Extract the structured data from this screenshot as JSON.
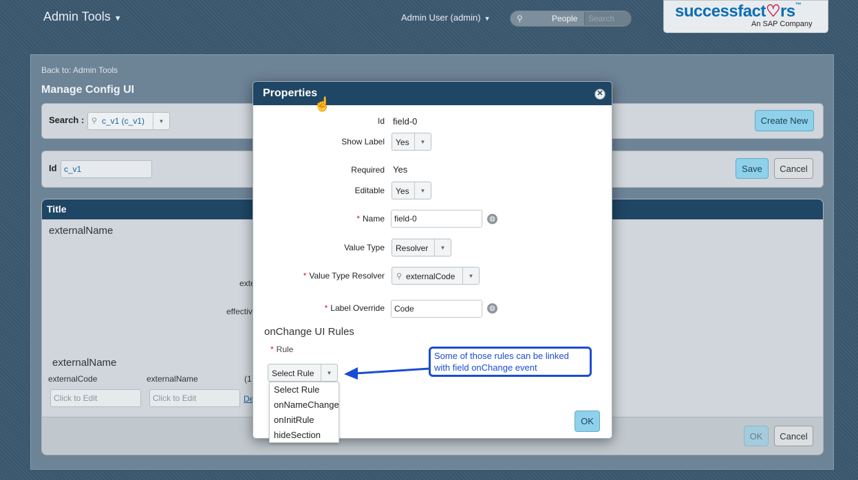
{
  "header": {
    "admin_tools": "Admin Tools",
    "admin_user": "Admin User (admin)",
    "search_scope": "People",
    "search_placeholder": "Search",
    "logo_text_a": "successfact",
    "logo_text_b": "rs",
    "logo_sub": "An SAP Company"
  },
  "page": {
    "back_link": "Back to: Admin Tools",
    "title": "Manage Config UI",
    "search_label": "Search :",
    "search_value": "c_v1 (c_v1)",
    "create_new": "Create New",
    "id_label": "Id",
    "id_value": "c_v1",
    "save": "Save",
    "cancel": "Cancel",
    "card_title": "Title",
    "bg_external_name": "externalName",
    "bg_ext_partial": "exte",
    "bg_effective_partial": "effectiv",
    "bg_section_external_name": "externalName",
    "bg_col_external_code": "externalCode",
    "bg_col_external_name": "externalName",
    "bg_col_partial": "(1",
    "click_to_edit_1": "Click to Edit",
    "click_to_edit_2": "Click to Edit",
    "bg_link_partial": "De",
    "footer_ok": "OK",
    "footer_cancel": "Cancel"
  },
  "modal": {
    "title": "Properties",
    "fields": {
      "id_label": "Id",
      "id_value": "field-0",
      "show_label_label": "Show Label",
      "show_label_value": "Yes",
      "required_label": "Required",
      "required_value": "Yes",
      "editable_label": "Editable",
      "editable_value": "Yes",
      "name_label": "Name",
      "name_value": "field-0",
      "value_type_label": "Value Type",
      "value_type_value": "Resolver",
      "value_type_resolver_label": "Value Type Resolver",
      "value_type_resolver_value": "externalCode",
      "label_override_label": "Label Override",
      "label_override_value": "Code"
    },
    "section_title": "onChange UI Rules",
    "rule_label": "Rule",
    "rule_selected": "Select Rule",
    "rule_options": [
      "Select Rule",
      "onNameChange",
      "onInitRule",
      "hideSection"
    ],
    "callout": "Some of those rules can be linked with field onChange event",
    "ok": "OK"
  }
}
